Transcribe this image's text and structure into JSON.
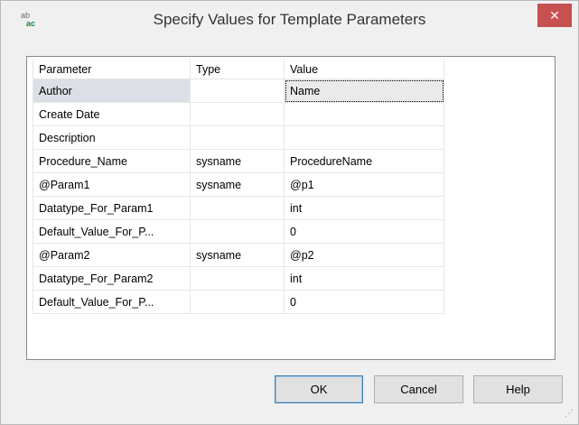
{
  "window": {
    "title": "Specify Values for Template Parameters",
    "icon_top": "ab",
    "icon_bottom": "ac",
    "close_glyph": "✕"
  },
  "table": {
    "headers": {
      "parameter": "Parameter",
      "type": "Type",
      "value": "Value"
    },
    "rows": [
      {
        "parameter": "Author",
        "type": "",
        "value": "Name"
      },
      {
        "parameter": "Create Date",
        "type": "",
        "value": ""
      },
      {
        "parameter": "Description",
        "type": "",
        "value": ""
      },
      {
        "parameter": "Procedure_Name",
        "type": "sysname",
        "value": "ProcedureName"
      },
      {
        "parameter": "@Param1",
        "type": "sysname",
        "value": "@p1"
      },
      {
        "parameter": "Datatype_For_Param1",
        "type": "",
        "value": "int"
      },
      {
        "parameter": "Default_Value_For_P...",
        "type": "",
        "value": "0"
      },
      {
        "parameter": "@Param2",
        "type": "sysname",
        "value": "@p2"
      },
      {
        "parameter": "Datatype_For_Param2",
        "type": "",
        "value": "int"
      },
      {
        "parameter": "Default_Value_For_P...",
        "type": "",
        "value": "0"
      }
    ]
  },
  "buttons": {
    "ok": "OK",
    "cancel": "Cancel",
    "help": "Help"
  },
  "colors": {
    "close_button": "#c75050",
    "selected_row": "#dcdfe6",
    "default_button_border": "#3c7fb1"
  }
}
